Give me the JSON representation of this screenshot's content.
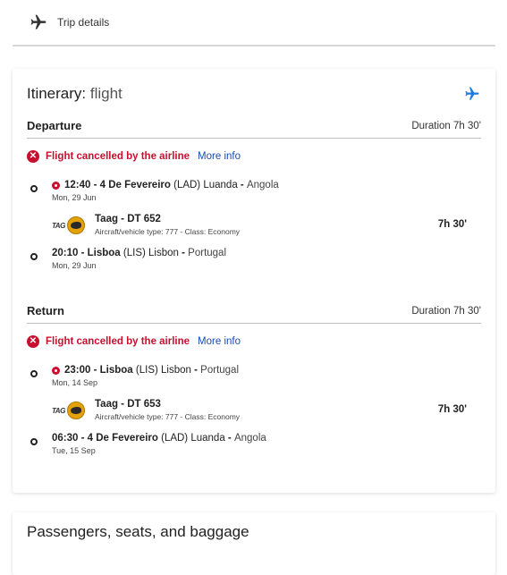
{
  "header": {
    "title": "Trip details",
    "icon": "plane-icon"
  },
  "itinerary": {
    "title_strong": "Itinerary:",
    "title_light": "flight",
    "accent_color": "#1f7ae0"
  },
  "departure": {
    "label": "Departure",
    "duration": "Duration 7h 30'",
    "cancel_text": "Flight cancelled by the airline",
    "more_info": "More info",
    "origin": {
      "time_code": "12:40 - 4 De Fevereiro",
      "code": "(LAD)",
      "city": "Luanda",
      "sep": "-",
      "country": "Angola",
      "date": "Mon, 29 Jun"
    },
    "flight": {
      "name": "Taag - DT 652",
      "meta": "Aircraft/vehicle type: 777 - Class: Economy",
      "duration": "7h 30'",
      "logo_text": "TAG"
    },
    "destination": {
      "time_code": "20:10 - Lisboa",
      "code": "(LIS)",
      "city": "Lisbon",
      "sep": "-",
      "country": "Portugal",
      "date": "Mon, 29 Jun"
    }
  },
  "return": {
    "label": "Return",
    "duration": "Duration 7h 30'",
    "cancel_text": "Flight cancelled by the airline",
    "more_info": "More info",
    "origin": {
      "time_code": "23:00 - Lisboa",
      "code": "(LIS)",
      "city": "Lisbon",
      "sep": "-",
      "country": "Portugal",
      "date": "Mon, 14 Sep"
    },
    "flight": {
      "name": "Taag - DT 653",
      "meta": "Aircraft/vehicle type: 777 - Class: Economy",
      "duration": "7h 30'",
      "logo_text": "TAG"
    },
    "destination": {
      "time_code": "06:30 - 4 De Fevereiro",
      "code": "(LAD)",
      "city": "Luanda",
      "sep": "-",
      "country": "Angola",
      "date": "Tue, 15 Sep"
    }
  },
  "passengers": {
    "title": "Passengers, seats, and baggage"
  },
  "colors": {
    "error": "#c8102e",
    "link": "#1a4bb8"
  }
}
